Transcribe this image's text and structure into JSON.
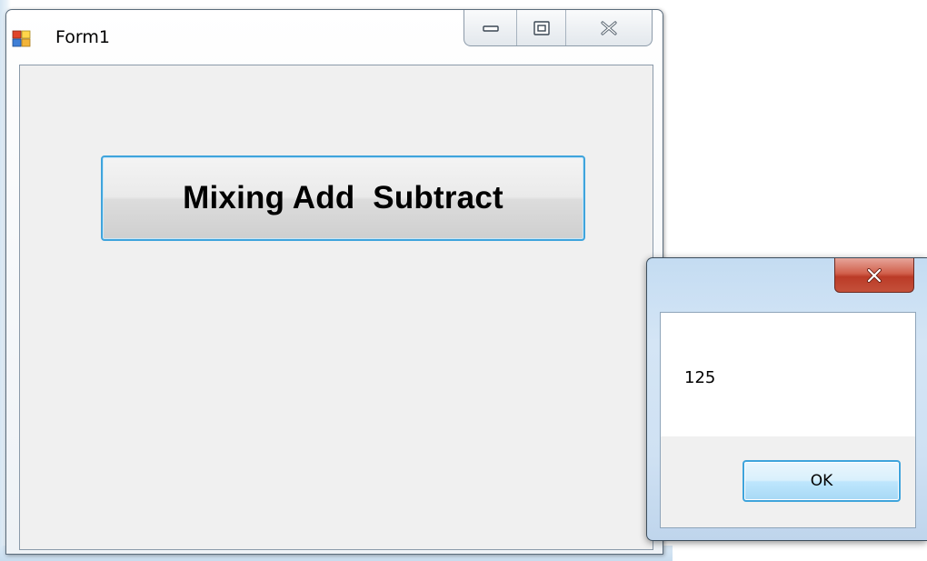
{
  "main_window": {
    "title": "Form1",
    "icon": "windows-form-icon",
    "caption_buttons": {
      "minimize_icon": "minimize-icon",
      "maximize_icon": "restore-icon",
      "close_icon": "close-icon"
    },
    "mix_button_label": "Mixing Add  Subtract"
  },
  "message_box": {
    "title": "",
    "close_icon": "close-icon",
    "message": "125",
    "ok_label": "OK"
  },
  "colors": {
    "focus_border": "#3fa4dc",
    "close_button_red": "#c4503a",
    "client_background": "#f0f0f0",
    "glass_blue": "#cfe1f3"
  }
}
